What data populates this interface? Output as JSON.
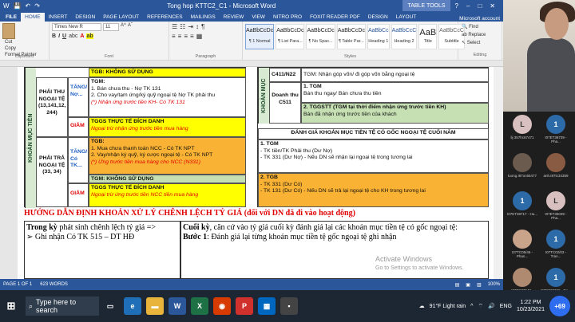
{
  "window": {
    "title": "Tong hop KTTC2_C1 - Microsoft Word",
    "context_group": "TABLE TOOLS",
    "account": "Microsoft account"
  },
  "tabs": [
    "FILE",
    "HOME",
    "INSERT",
    "DESIGN",
    "PAGE LAYOUT",
    "REFERENCES",
    "MAILINGS",
    "REVIEW",
    "VIEW",
    "NITRO PRO",
    "FOXIT READER PDF",
    "DESIGN",
    "LAYOUT"
  ],
  "ribbon": {
    "clipboard": {
      "cut": "Cut",
      "copy": "Copy",
      "format_painter": "Format Painter",
      "paste": "Paste",
      "label": "Clipboard"
    },
    "font": {
      "name": "Times New R",
      "size": "11",
      "label": "Font"
    },
    "paragraph_label": "Paragraph",
    "styles_label": "Styles",
    "styles": [
      {
        "sample": "AaBbCcDc",
        "name": "¶ 1 Normal"
      },
      {
        "sample": "AaBbCcDc",
        "name": "¶ List Para..."
      },
      {
        "sample": "AaBbCcDc",
        "name": "¶ No Spac..."
      },
      {
        "sample": "AaBbCcDc",
        "name": "¶ Table Par..."
      },
      {
        "sample": "AaBbCc",
        "name": "Heading 1"
      },
      {
        "sample": "AaBbCcC",
        "name": "Heading 2"
      },
      {
        "sample": "AaB",
        "name": "Title"
      },
      {
        "sample": "AaBbCcC",
        "name": "Subtitle"
      }
    ],
    "editing": {
      "find": "Find",
      "replace": "Replace",
      "select": "Select",
      "label": "Editing"
    }
  },
  "left_table": {
    "side_label": "KHOẢN MỤC TIỀN",
    "tgb_top": "TGB: KHÔNG SỬ DỤNG",
    "phai_thu": "PHẢI THU NGOẠI TỆ (13,141,12, 244)",
    "tang_no": "TĂNG/ Nợ...",
    "tgm_title": "TGM:",
    "tgm_line1": "1. Bán chưa thu - Nợ TK 131",
    "tgm_line2": "2. Cho vay/tạm ứng/ký quỹ ngoại tệ Nợ TK phải thu",
    "tgm_note": "(*) Nhận ứng trước tiền KH- Có TK 131",
    "giam": "GIẢM",
    "tggs_title": "TGGS THỰC TẾ ĐÍCH DANH",
    "tggs_note": "Ngoại trừ nhận ứng trước tiền mua hàng",
    "phai_tra": "PHẢI TRẢ NGOẠI TỆ (33, 34)",
    "tang_co": "TĂNG/ Có TK...",
    "tgb_title": "TGB:",
    "tgb_line1": "1. Mua chưa thanh toán NCC - Có TK NPT",
    "tgb_line2": "2. Vay/nhận ký quỹ, ký cược ngoại tệ - Có TK NPT",
    "tgb_note": "(*) Ứng trước tiền mua hàng cho NCC (N331)",
    "tgm_none": "TGM: KHÔNG SỬ DỤNG",
    "giam2": "GIẢM",
    "tggs2_title": "TGGS THỰC TẾ ĐÍCH DANH",
    "tggs2_note": "Ngoại trừ ứng trước tiền NCC tiền mua hàng"
  },
  "right_table": {
    "side_label": "KHOẢN MỤC",
    "c411": "C411/N22",
    "c411_text": "TGM: Nhận góp vốn/ đi góp vốn bằng ngoại tệ",
    "doanh_thu": "Doanh thu C511",
    "r1_title": "1. TGM",
    "r1_text": "Bán thu ngay/ Bán chưa thu tiền",
    "r2_title": "2. TGGSTT (TGM tại thời điểm nhận ứng trước tiền KH)",
    "r2_text": "Bán đã nhận ứng trước tiền của khách",
    "eval_title": "ĐÁNH GIÁ KHOẢN MỤC TIỀN TỆ CÓ GỐC NGOẠI TỆ CUỐI NĂM",
    "e1_title": "1. TGM",
    "e1_l1": "- TK tiền/TK Phải thu (Dư Nợ)",
    "e1_l2": "- TK 331 (Dư Nợ) - Nếu DN sẽ nhận lại ngoại tệ trong tương lai",
    "e2_title": "2. TGB",
    "e2_l1": "- TK 331 (Dư Có)",
    "e2_l2": "- TK 131 (Dư Có) - Nếu DN sẽ trả lại ngoại tệ cho KH trong tương lai"
  },
  "doc": {
    "heading": "HƯỚNG DẪN ĐỊNH KHOẢN XỬ LÝ CHÊNH LỆCH TỶ GIÁ (đối với DN đã đi vào hoạt động)",
    "left_line1_bold": "Trong kỳ",
    "left_line1": " phát sinh chênh lệch tỷ giá =>",
    "left_line2": "➢  Ghi nhận Có TK 515 – DT HĐ",
    "right_line1_bold": "Cuối kỳ",
    "right_line1": ", căn cứ vào tỷ giá cuối kỳ đánh giá lại các khoản mục tiền tệ có gốc ngoại tệ:",
    "right_line2_bold": "Bước 1",
    "right_line2": ": Đánh giá lại từng khoản mục tiền tệ gốc ngoại tệ ghi nhận",
    "watermark1": "Activate Windows",
    "watermark2": "Go to Settings to activate Windows."
  },
  "statusbar": {
    "page": "PAGE 1 OF 1",
    "words": "623 WORDS",
    "zoom": "100%"
  },
  "taskbar": {
    "search": "Type here to search",
    "weather": "91°F Light rain",
    "lang": "ENG",
    "time": "1:22 PM",
    "date": "10/23/2021"
  },
  "participants": [
    {
      "initial": "L",
      "label": "lij 357hc67471",
      "color": "#d9c0c0"
    },
    {
      "initial": "1",
      "label": "I07ET38739 - Pha...",
      "color": "#2c6aa8"
    },
    {
      "initial": "",
      "label": "tuong.I87oc65477",
      "color": "#6b5a4e"
    },
    {
      "initial": "",
      "label": "anh.I87tc34359",
      "color": "#8a5b43"
    },
    {
      "initial": "1",
      "label": "I07ET38717 - Hu...",
      "color": "#2c6aa8"
    },
    {
      "initial": "L",
      "label": "I07ET36039 - Pha...",
      "color": "#d9c0c0"
    },
    {
      "initial": "",
      "label": "I37TC05/46 - Phan...",
      "color": "#c9a38a"
    },
    {
      "initial": "1",
      "label": "I07TC02/03 - Tran...",
      "color": "#2c6aa8"
    },
    {
      "initial": "",
      "label": "I07TC37548 - Tran...",
      "color": "#b08a70"
    },
    {
      "initial": "1",
      "label": "I07ET38729 - Do...",
      "color": "#2c6aa8"
    },
    {
      "initial": "",
      "label": "I37TJ46 - Minh N...",
      "color": "#5d4a3a"
    },
    {
      "initial": "+69",
      "label": "",
      "color": "#2f6df0"
    }
  ]
}
